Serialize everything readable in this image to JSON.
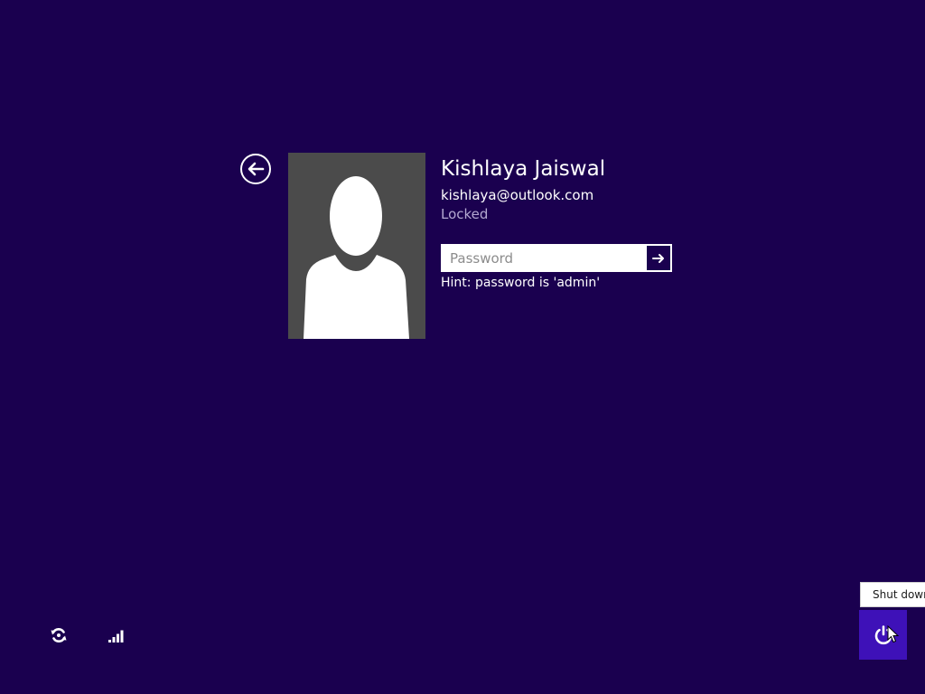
{
  "user": {
    "name": "Kishlaya Jaiswal",
    "email": "kishlaya@outlook.com",
    "status": "Locked"
  },
  "password": {
    "placeholder": "Password",
    "value": "",
    "hint": "Hint: password is 'admin'"
  },
  "controls": {
    "back_icon": "arrow-left-circle",
    "submit_icon": "arrow-right",
    "ease_of_access_icon": "ease-of-access",
    "network_icon": "signal-bars",
    "power_icon": "power"
  },
  "power_tooltip": "Shut down",
  "colors": {
    "background": "#1a004f",
    "power_button": "#3e11b8",
    "user_tile": "#4b4b4b",
    "status_text": "#b3a9d1"
  }
}
